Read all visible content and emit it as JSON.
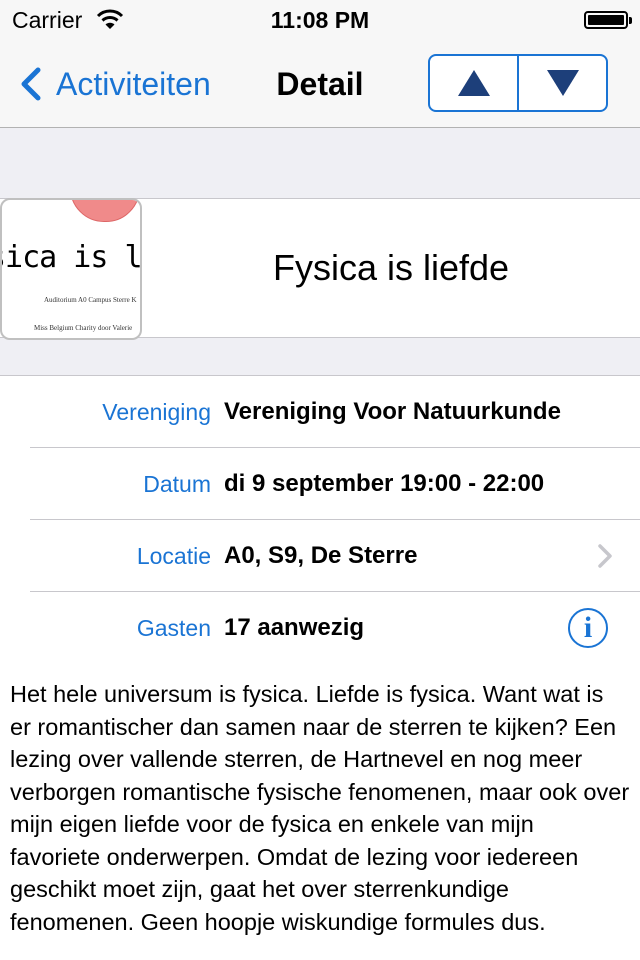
{
  "status": {
    "carrier": "Carrier",
    "time": "11:08 PM"
  },
  "nav": {
    "back_label": "Activiteiten",
    "title": "Detail"
  },
  "event": {
    "title": "Fysica is liefde",
    "thumb": {
      "text": "sica is liefd",
      "line1": "Auditorium A0 Campus Sterre K",
      "line2": "Miss Belgium Charity door Valerie"
    }
  },
  "details": [
    {
      "key": "Vereniging",
      "value": "Vereniging Voor Natuurkunde"
    },
    {
      "key": "Datum",
      "value": "di 9 september 19:00 - 22:00"
    },
    {
      "key": "Locatie",
      "value": "A0, S9, De Sterre"
    },
    {
      "key": "Gasten",
      "value": "17 aanwezig"
    }
  ],
  "description": "Het hele universum is fysica. Liefde is fysica. Want wat is er romantischer dan samen naar de sterren te kijken? Een lezing over vallende sterren, de Hartnevel en nog meer verborgen romantische fysische fenomenen, maar ook over mijn eigen liefde voor de fysica en enkele van mijn favoriete onderwerpen. Omdat de lezing voor iedereen geschikt moet zijn, gaat het over sterrenkundige fenomenen. Geen hoopje wiskundige formules dus.",
  "colors": {
    "accent": "#1a74d4",
    "background": "#efeff4"
  }
}
